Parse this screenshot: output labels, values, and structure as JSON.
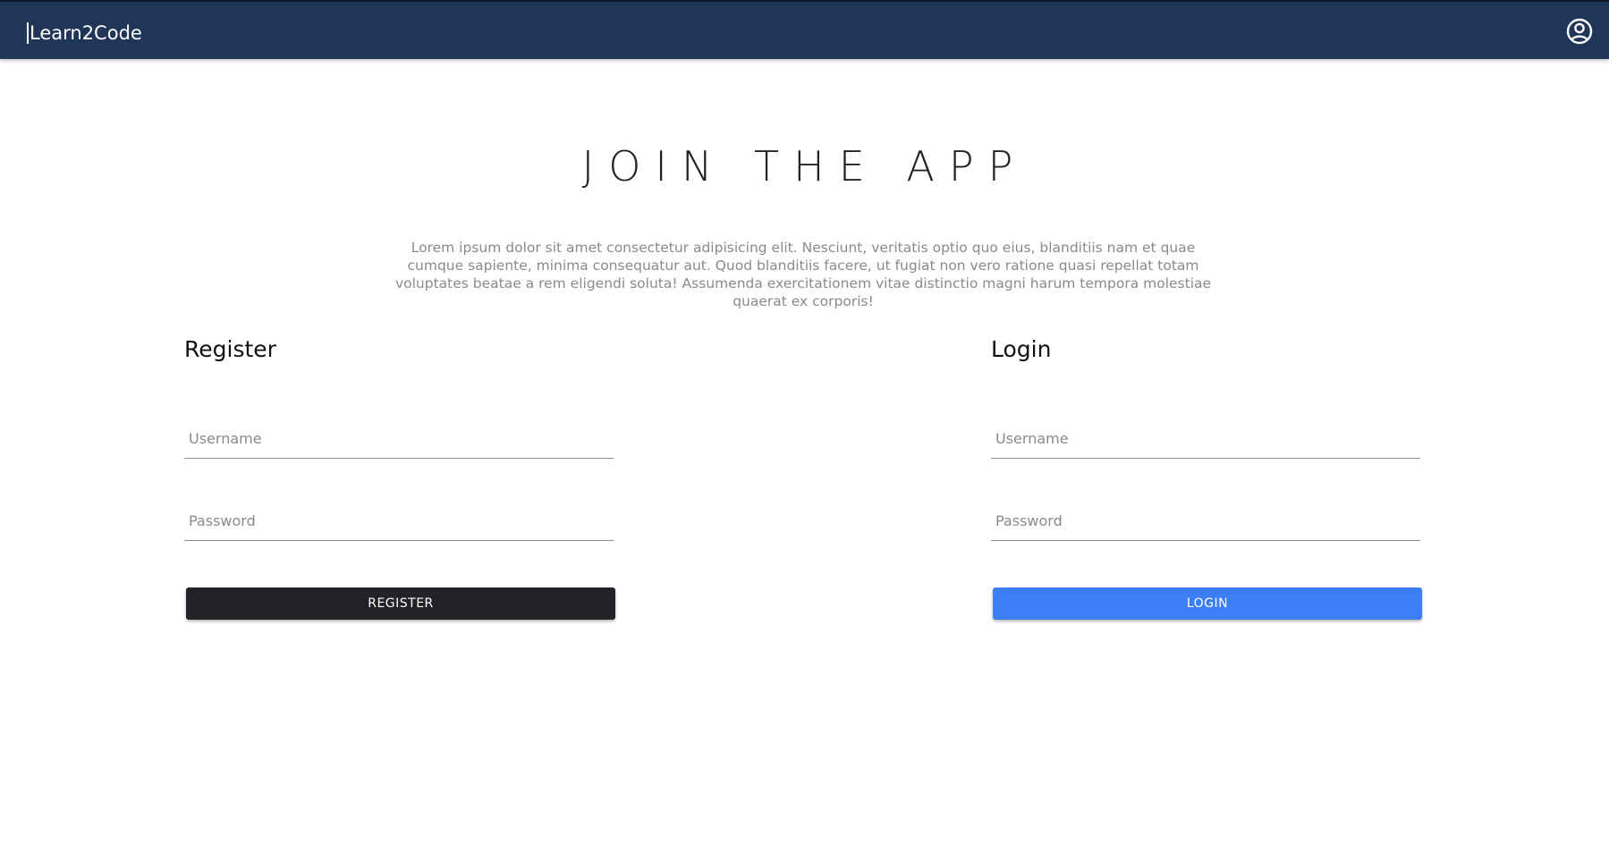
{
  "app": {
    "brand": "Learn2Code",
    "account_icon": "account-circle-icon"
  },
  "hero": {
    "title": "JOIN THE APP",
    "description": "Lorem ipsum dolor sit amet consectetur adipisicing elit. Nesciunt, veritatis optio quo eius, blanditiis nam et quae cumque sapiente, minima consequatur aut. Quod blanditiis facere, ut fugiat non vero ratione quasi repellat totam voluptates beatae a rem eligendi soluta! Assumenda exercitationem vitae distinctio magni harum tempora molestiae quaerat ex corporis!"
  },
  "register": {
    "title": "Register",
    "username_placeholder": "Username",
    "username_value": "",
    "password_placeholder": "Password",
    "password_value": "",
    "button_label": "REGISTER"
  },
  "login": {
    "title": "Login",
    "username_placeholder": "Username",
    "username_value": "",
    "password_placeholder": "Password",
    "password_value": "",
    "button_label": "LOGIN"
  },
  "colors": {
    "navbar": "#1f3659",
    "register_button": "#222326",
    "login_button": "#3b7ef8"
  }
}
